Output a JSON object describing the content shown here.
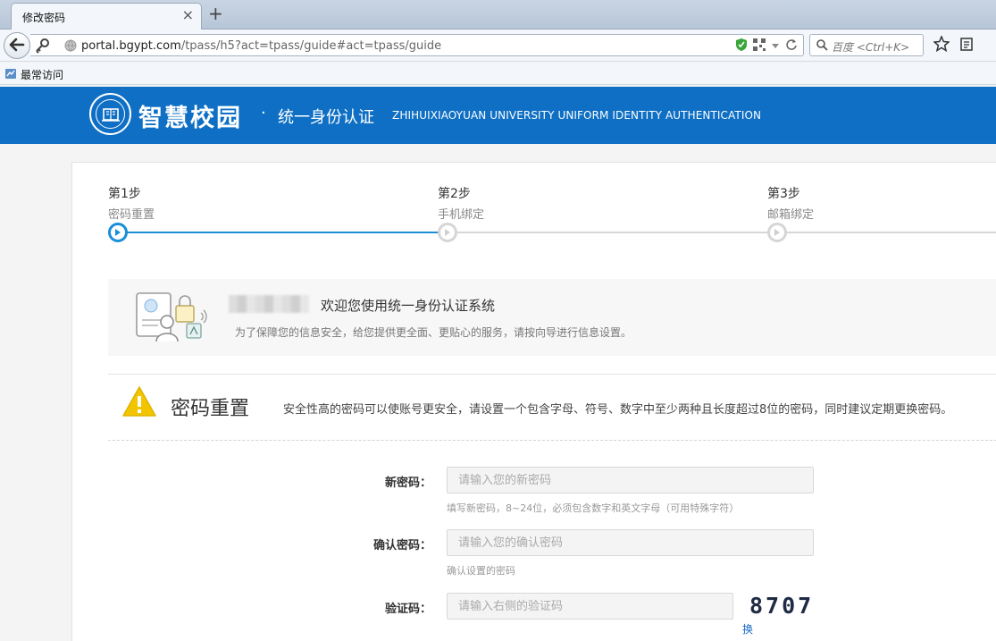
{
  "browser": {
    "tab_title": "修改密码",
    "tab_close": "×",
    "new_tab": "+",
    "url_host": "portal.bgypt.com",
    "url_rest": "/tpass/h5?act=tpass/guide#act=tpass/guide",
    "search_placeholder": "百度 <Ctrl+K>",
    "bookmark_label": "最常访问"
  },
  "site": {
    "brand": "智慧校园",
    "dot": "·",
    "subtitle": "统一身份认证",
    "english": "ZHIHUIXIAOYUAN UNIVERSITY UNIFORM IDENTITY AUTHENTICATION",
    "header_color": "#0e6fc4"
  },
  "steps": [
    {
      "no": "第1步",
      "name": "密码重置",
      "active": true
    },
    {
      "no": "第2步",
      "name": "手机绑定",
      "active": false
    },
    {
      "no": "第3步",
      "name": "邮箱绑定",
      "active": false
    }
  ],
  "welcome": {
    "title": "欢迎您使用统一身份认证系统",
    "desc": "为了保障您的信息安全，给您提供更全面、更贴心的服务，请按向导进行信息设置。"
  },
  "section": {
    "title": "密码重置",
    "desc": "安全性高的密码可以使账号更安全，请设置一个包含字母、符号、数字中至少两种且长度超过8位的密码，同时建议定期更换密码。"
  },
  "form": {
    "new_password": {
      "label": "新密码：",
      "placeholder": "请输入您的新密码",
      "hint": "填写新密码，8~24位，必须包含数字和英文字母（可用特殊字符）"
    },
    "confirm_password": {
      "label": "确认密码：",
      "placeholder": "请输入您的确认密码",
      "hint": "确认设置的密码"
    },
    "captcha": {
      "label": "验证码：",
      "placeholder": "请输入右侧的验证码",
      "code": "8707",
      "refresh": "换一张"
    }
  }
}
